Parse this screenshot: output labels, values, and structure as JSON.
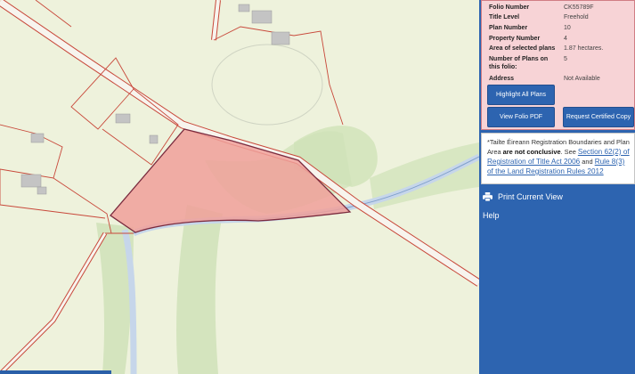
{
  "folio": {
    "rows": [
      {
        "label": "Folio Number",
        "value": "CK55789F"
      },
      {
        "label": "Title Level",
        "value": "Freehold"
      },
      {
        "label": "Plan Number",
        "value": "10"
      },
      {
        "label": "Property Number",
        "value": "4"
      },
      {
        "label": "Area of selected plans",
        "value": "1.87 hectares."
      },
      {
        "label_line1": "Number of Plans on",
        "label_line2": "this folio:",
        "value": "5"
      },
      {
        "label": "Address",
        "value": "Not Available"
      }
    ],
    "buttons": {
      "highlight_all": "Highlight All Plans",
      "view_pdf": "View Folio PDF",
      "certified_copy": "Request Certified Copy"
    }
  },
  "disclaimer": {
    "line1": "*Tailte Éireann Registration Boundaries and Plan",
    "line2_pre": "Area ",
    "line2_bold": "are not conclusive",
    "line2_mid": ". See ",
    "line2_link": "Section 62(2) of",
    "line3_link_a": "Registration of Title Act 2006",
    "line3_mid": " and ",
    "line3_link_b": "Rule 8(3)",
    "line4_link": "of the Land Registration Rules 2012"
  },
  "menu": {
    "print": "Print Current View",
    "help": "Help"
  },
  "colors": {
    "map_background": "#eef2dc",
    "parcel_fill": "#f0a09a",
    "boundary": "#c8483a",
    "panel_blue": "#2d64b0",
    "folio_panel": "#f7d3d6"
  },
  "icons": {
    "print": "print-icon"
  }
}
